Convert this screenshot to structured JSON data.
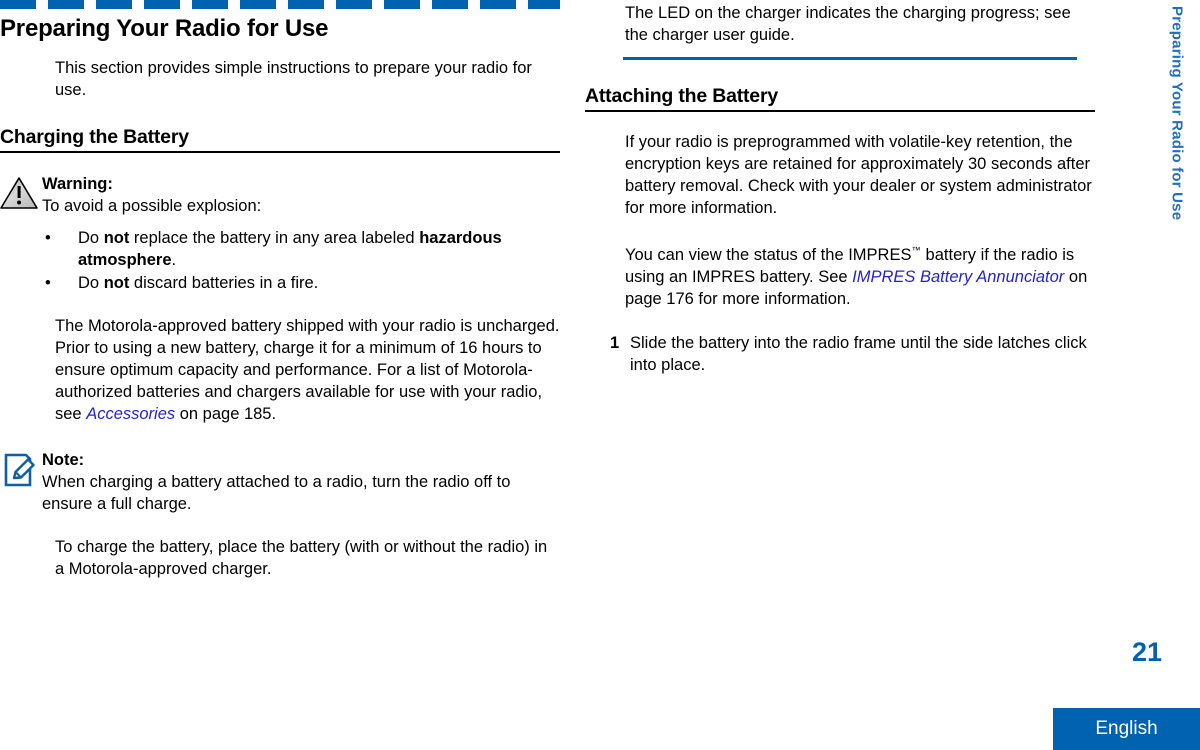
{
  "colors": {
    "brand_blue": "#0062b1",
    "xref_blue": "#2222dd",
    "sidetab_blue": "#1f6fc4"
  },
  "side_tab": {
    "label": "Preparing Your Radio for Use"
  },
  "footer": {
    "page_number": "21",
    "language": "English"
  },
  "left_column": {
    "chapter_title": "Preparing Your Radio for Use",
    "intro_paragraph": "This section provides simple instructions to prepare your radio for use.",
    "section_heading": "Charging the Battery",
    "warning": {
      "icon": "warning-triangle-icon",
      "title": "Warning:",
      "lead": "To avoid a possible explosion:",
      "bullets": [
        {
          "parts": [
            {
              "text": "Do ",
              "style": "normal"
            },
            {
              "text": "not",
              "style": "bold"
            },
            {
              "text": " replace the battery in any area labeled ",
              "style": "normal"
            },
            {
              "text": "hazardous atmosphere",
              "style": "bold"
            },
            {
              "text": ".",
              "style": "normal"
            }
          ]
        },
        {
          "parts": [
            {
              "text": "Do ",
              "style": "normal"
            },
            {
              "text": "not",
              "style": "bold"
            },
            {
              "text": " discard batteries in a fire.",
              "style": "normal"
            }
          ]
        }
      ]
    },
    "battery_paragraph": {
      "text_before_link": "The Motorola-approved battery shipped with your radio is uncharged. Prior to using a new battery, charge it for a minimum of 16 hours to ensure optimum capacity and performance. For a list of Motorola-authorized batteries and chargers available for use with your radio, see ",
      "link_text": "Accessories",
      "text_after_link": " on page 185."
    },
    "note": {
      "icon": "note-pencil-icon",
      "title": "Note:",
      "text": "When charging a battery attached to a radio, turn the radio off to ensure a full charge."
    },
    "charge_paragraph": "To charge the battery, place the battery (with or without the radio) in a Motorola-approved charger."
  },
  "right_column": {
    "led_paragraph": "The LED on the charger indicates the charging progress; see the charger user guide.",
    "section_heading": "Attaching the Battery",
    "volatile_key_paragraph": "If your radio is preprogrammed with volatile-key retention, the encryption keys are retained for approximately 30 seconds after battery removal. Check with your dealer or system administrator for more information.",
    "impres_paragraph": {
      "text_before_tm": "You can view the status of the IMPRES",
      "tm_symbol": "™",
      "text_after_tm": " battery if the radio is using an IMPRES battery. See ",
      "link_text": "IMPRES Battery Annunciator",
      "text_after_link": " on page 176 for more information."
    },
    "steps": [
      {
        "number": "1",
        "text": "Slide the battery into the radio frame until the side latches click into place."
      }
    ]
  }
}
